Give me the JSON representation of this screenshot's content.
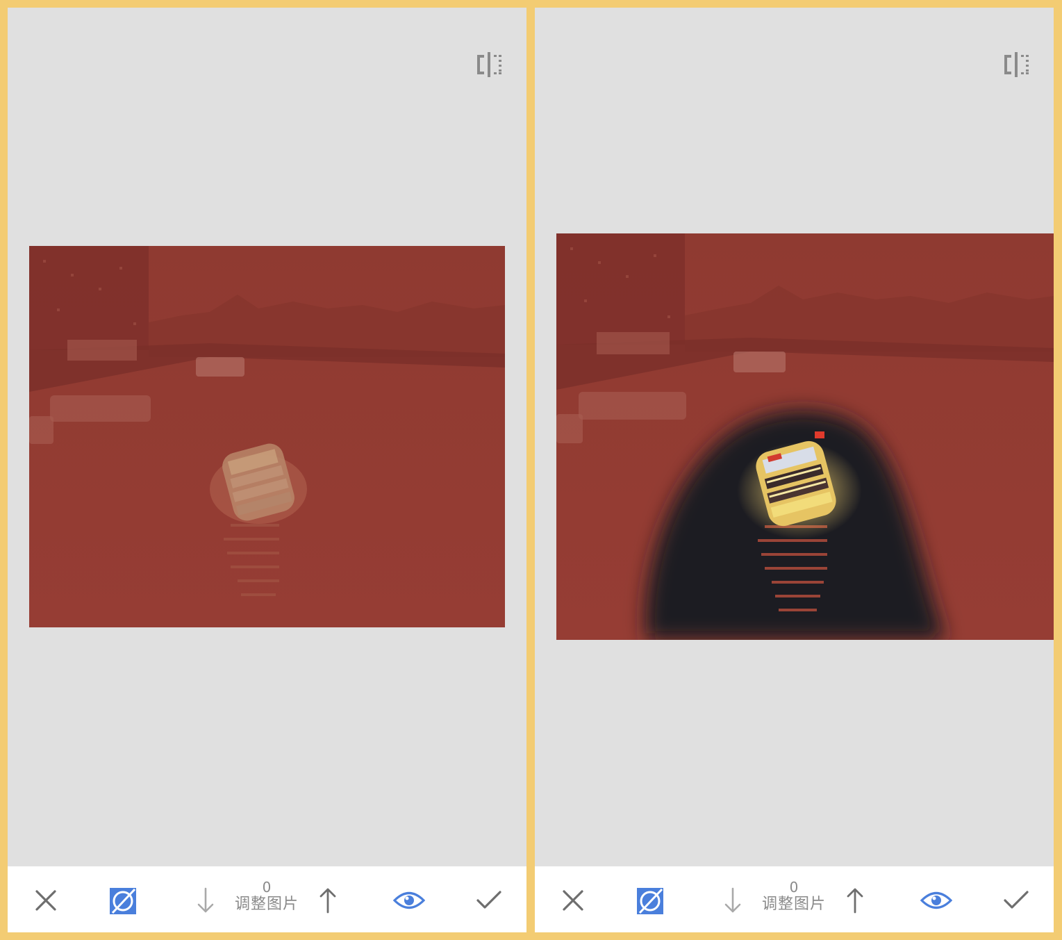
{
  "colors": {
    "frame": "#f3cc73",
    "canvas": "#e0e0e0",
    "toolbar": "#ffffff",
    "mask_overlay": "#9b3b33",
    "accent": "#4a7fdc",
    "icon_gray": "#6e6e6e",
    "icon_light": "#a9a9a9"
  },
  "panels": [
    {
      "id": "left",
      "brush_mask": "none",
      "toolbar": {
        "cancel_icon": "close-icon",
        "mask_toggle_icon": "mask-toggle-icon",
        "decrease_icon": "arrow-down-icon",
        "value": "0",
        "label": "调整图片",
        "increase_icon": "arrow-up-icon",
        "visibility_icon": "eye-icon",
        "apply_icon": "check-icon"
      },
      "compare_icon": "compare-split-icon"
    },
    {
      "id": "right",
      "brush_mask": "boat-region-brushed",
      "toolbar": {
        "cancel_icon": "close-icon",
        "mask_toggle_icon": "mask-toggle-icon",
        "decrease_icon": "arrow-down-icon",
        "value": "0",
        "label": "调整图片",
        "increase_icon": "arrow-up-icon",
        "visibility_icon": "eye-icon",
        "apply_icon": "check-icon"
      },
      "compare_icon": "compare-split-icon"
    }
  ]
}
